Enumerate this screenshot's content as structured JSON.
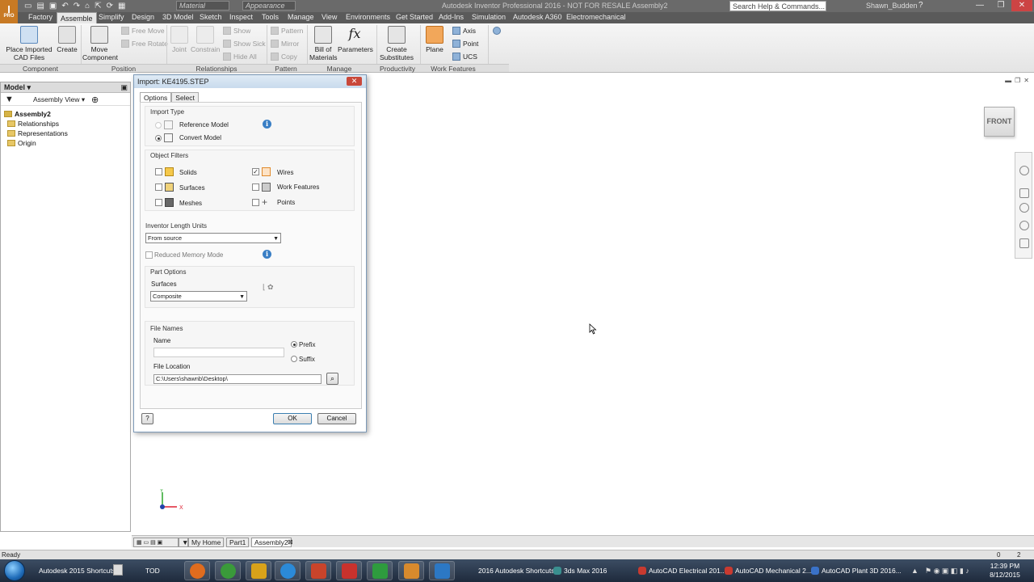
{
  "window": {
    "title": "Autodesk Inventor Professional 2016 - NOT FOR RESALE   Assembly2",
    "logo": "I",
    "logo_sub": "PRO",
    "material_combo": "Material",
    "appearance_combo": "Appearance",
    "search_placeholder": "Search Help & Commands...",
    "user": "Shawn_Budden",
    "help": "?",
    "minimize": "—",
    "restore": "❐",
    "close": "✕"
  },
  "menu": {
    "tabs": [
      "Factory",
      "Assemble",
      "Simplify",
      "Design",
      "3D Model",
      "Sketch",
      "Inspect",
      "Tools",
      "Manage",
      "View",
      "Environments",
      "Get Started",
      "Add-Ins",
      "Simulation",
      "Autodesk A360",
      "Electromechanical"
    ],
    "active_tab": "Assemble"
  },
  "ribbon": {
    "place_imported_cad": "Place Imported\nCAD Files",
    "create": "Create",
    "free_move": "Free Move",
    "free_rotate": "Free Rotate",
    "move_component": "Move\nComponent",
    "joint": "Joint",
    "constrain": "Constrain",
    "show": "Show",
    "show_sick": "Show Sick",
    "hide_all": "Hide All",
    "pattern": "Pattern",
    "mirror": "Mirror",
    "copy": "Copy",
    "bom": "Bill of\nMaterials",
    "parameters": "Parameters",
    "create_substitutes": "Create\nSubstitutes",
    "plane": "Plane",
    "axis": "Axis",
    "point": "Point",
    "ucs": "UCS",
    "panels": {
      "component": "Component",
      "position": "Position",
      "relationships": "Relationships",
      "pattern": "Pattern",
      "manage": "Manage",
      "productivity": "Productivity",
      "work_features": "Work Features"
    }
  },
  "browser": {
    "title": "Model",
    "view": "Assembly View",
    "root": "Assembly2",
    "items": [
      "Relationships",
      "Representations",
      "Origin"
    ]
  },
  "dialog": {
    "title": "Import:  KE4195.STEP",
    "tabs": [
      "Options",
      "Select"
    ],
    "import_type": {
      "label": "Import Type",
      "reference_model": "Reference Model",
      "convert_model": "Convert Model"
    },
    "object_filters": {
      "label": "Object Filters",
      "solids": "Solids",
      "surfaces": "Surfaces",
      "meshes": "Meshes",
      "wires": "Wires",
      "work_features": "Work Features",
      "points": "Points"
    },
    "length_units": {
      "label": "Inventor Length Units",
      "value": "From source"
    },
    "reduced_memory": "Reduced Memory Mode",
    "part_options": {
      "label": "Part Options",
      "surfaces_label": "Surfaces",
      "surfaces_value": "Composite"
    },
    "file_names": {
      "label": "File Names",
      "name_label": "Name",
      "name_value": "",
      "prefix": "Prefix",
      "suffix": "Suffix",
      "location_label": "File Location",
      "location_value": "C:\\Users\\shawnb\\Desktop\\"
    },
    "ok": "OK",
    "cancel": "Cancel",
    "help": "?"
  },
  "viewport": {
    "viewcube": "FRONT",
    "triad_x": "X",
    "triad_y": "Y"
  },
  "doc_tabs": [
    "My Home",
    "Part1",
    "Assembly2"
  ],
  "status": {
    "left": "Ready",
    "num1": "0",
    "num2": "2"
  },
  "taskbar": {
    "items": [
      {
        "label": "Autodesk 2015 Shortcuts",
        "color": "#d9d9d9"
      },
      {
        "label": "TOD",
        "color": "#d9d9d9"
      },
      {
        "label": "2016 Autodesk Shortcuts",
        "color": "#d9d9d9"
      },
      {
        "label": "3ds Max 2016",
        "color": "#3a8f8f"
      },
      {
        "label": "AutoCAD Electrical 201...",
        "color": "#c83a30"
      },
      {
        "label": "AutoCAD Mechanical 2...",
        "color": "#c83a30"
      },
      {
        "label": "AutoCAD Plant 3D 2016...",
        "color": "#3a72c8"
      }
    ],
    "pinned": [
      {
        "name": "firefox",
        "color": "#e06c1e"
      },
      {
        "name": "chrome",
        "color": "#3a9a3a"
      },
      {
        "name": "autodesk-360",
        "color": "#d8a21a"
      },
      {
        "name": "internet-explorer",
        "color": "#2b8ad8"
      },
      {
        "name": "powerpoint",
        "color": "#c9442b"
      },
      {
        "name": "autocad",
        "color": "#c8322d"
      },
      {
        "name": "green-app",
        "color": "#2e9b3e"
      },
      {
        "name": "inventor",
        "color": "#d88a2d"
      },
      {
        "name": "s-app",
        "color": "#2c78c4"
      }
    ],
    "time": "12:39 PM",
    "date": "8/12/2015"
  }
}
